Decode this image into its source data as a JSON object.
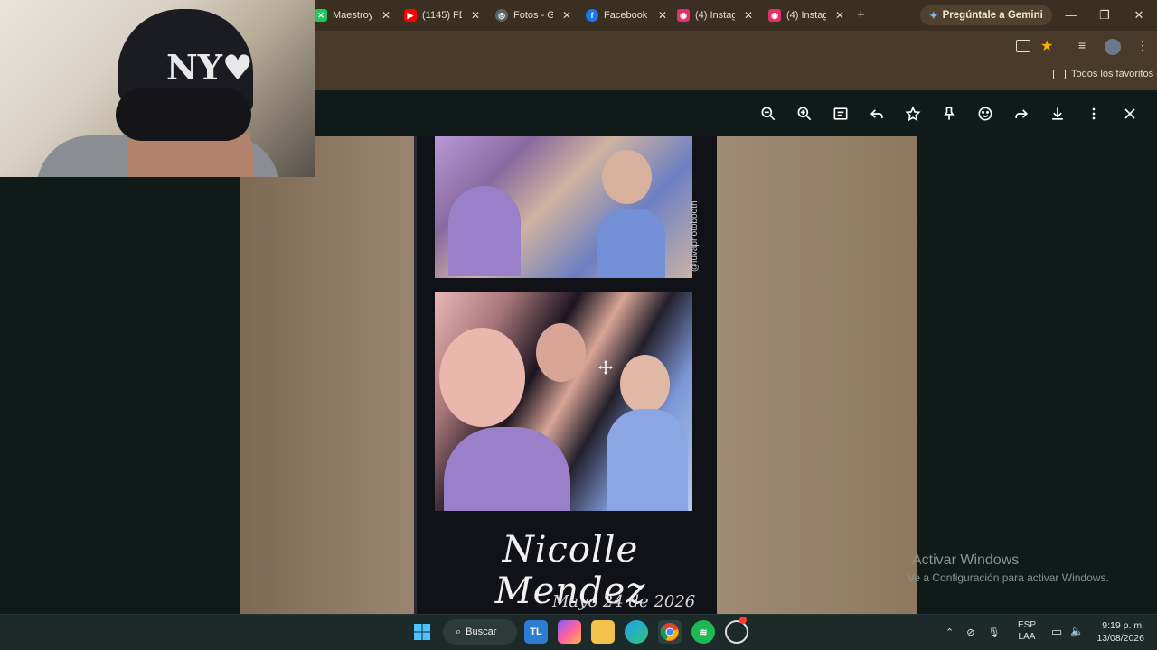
{
  "browser": {
    "tabs": [
      {
        "label": "Maestroy",
        "icon": "x-green-icon",
        "color": "#22c55e"
      },
      {
        "label": "(1145) FD",
        "icon": "youtube-icon",
        "color": "#ff0000"
      },
      {
        "label": "Fotos - G",
        "icon": "globe-icon",
        "color": "#9aa0a6"
      },
      {
        "label": "Facebook",
        "icon": "facebook-icon",
        "color": "#1877f2"
      },
      {
        "label": "(4) Instag",
        "icon": "instagram-icon",
        "color": "#e1306c"
      },
      {
        "label": "(4) Instag",
        "icon": "instagram-icon",
        "color": "#e1306c"
      }
    ],
    "new_tab": "+",
    "gemini_label": "Pregúntale a Gemini",
    "window_controls": {
      "minimize": "—",
      "restore": "❐",
      "close": "✕"
    },
    "bookmarks_folder": "Todos los favoritos"
  },
  "viewer": {
    "toolbar": [
      "zoom-out-icon",
      "zoom-in-icon",
      "caption-icon",
      "reply-icon",
      "star-icon",
      "pin-icon",
      "emoji-icon",
      "forward-icon",
      "download-icon",
      "more-icon",
      "close-icon"
    ]
  },
  "photo": {
    "name_text": "Nicolle Mendez",
    "date_text": "Mayo 24 de 2026",
    "handle_text": "@luvaphotobooth"
  },
  "watermark": {
    "title": "Activar Windows",
    "subtitle": "Ve a Configuración para activar Windows."
  },
  "taskbar": {
    "search_label": "Buscar",
    "apps": [
      "start-icon",
      "tl-icon",
      "copilot-icon",
      "file-explorer-icon",
      "edge-icon",
      "chrome-icon",
      "spotify-icon",
      "app-icon"
    ],
    "language": {
      "line1": "ESP",
      "line2": "LAA"
    },
    "time": "9:19 p. m.",
    "date": "13/08/2026"
  }
}
